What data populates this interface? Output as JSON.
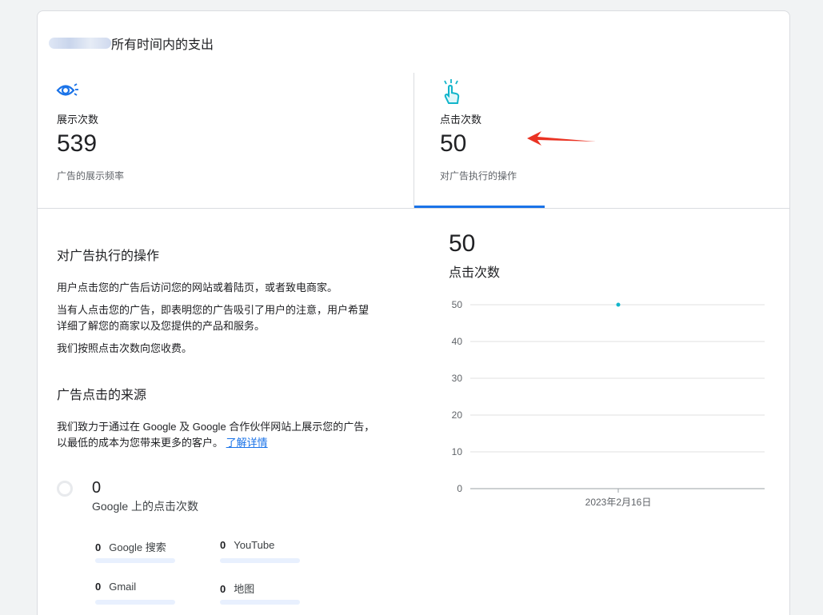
{
  "header": {
    "title": "所有时间内的支出"
  },
  "tabs": [
    {
      "label": "展示次数",
      "value": "539",
      "desc": "广告的展示频率",
      "icon": "eye-icon"
    },
    {
      "label": "点击次数",
      "value": "50",
      "desc": "对广告执行的操作",
      "icon": "touch-icon",
      "selected": true
    }
  ],
  "colors": {
    "accent": "#1a73e8",
    "click_icon": "#12b5cb",
    "point": "#12b5cb",
    "arrow": "#ea3323"
  },
  "about": {
    "title": "对广告执行的操作",
    "p1": "用户点击您的广告后访问您的网站或着陆页，或者致电商家。",
    "p2": "当有人点击您的广告，即表明您的广告吸引了用户的注意，用户希望详细了解您的商家以及您提供的产品和服务。",
    "p3": "我们按照点击次数向您收费。"
  },
  "source": {
    "title": "广告点击的来源",
    "text": "我们致力于通过在 Google 及 Google 合作伙伴网站上展示您的广告，以最低的成本为您带来更多的客户。",
    "link": "了解详情",
    "google_total": "0",
    "google_label": "Google 上的点击次数",
    "items": [
      {
        "value": "0",
        "label": "Google 搜索"
      },
      {
        "value": "0",
        "label": "YouTube"
      },
      {
        "value": "0",
        "label": "Gmail"
      },
      {
        "value": "0",
        "label": "地图"
      }
    ]
  },
  "chart_data": {
    "type": "line",
    "value_display": "50",
    "title": "点击次数",
    "x": [
      "2023年2月16日"
    ],
    "series": [
      {
        "values": [
          50
        ]
      }
    ],
    "ylim": [
      0,
      50
    ],
    "yticks": [
      0,
      10,
      20,
      30,
      40,
      50
    ],
    "grid": true
  }
}
